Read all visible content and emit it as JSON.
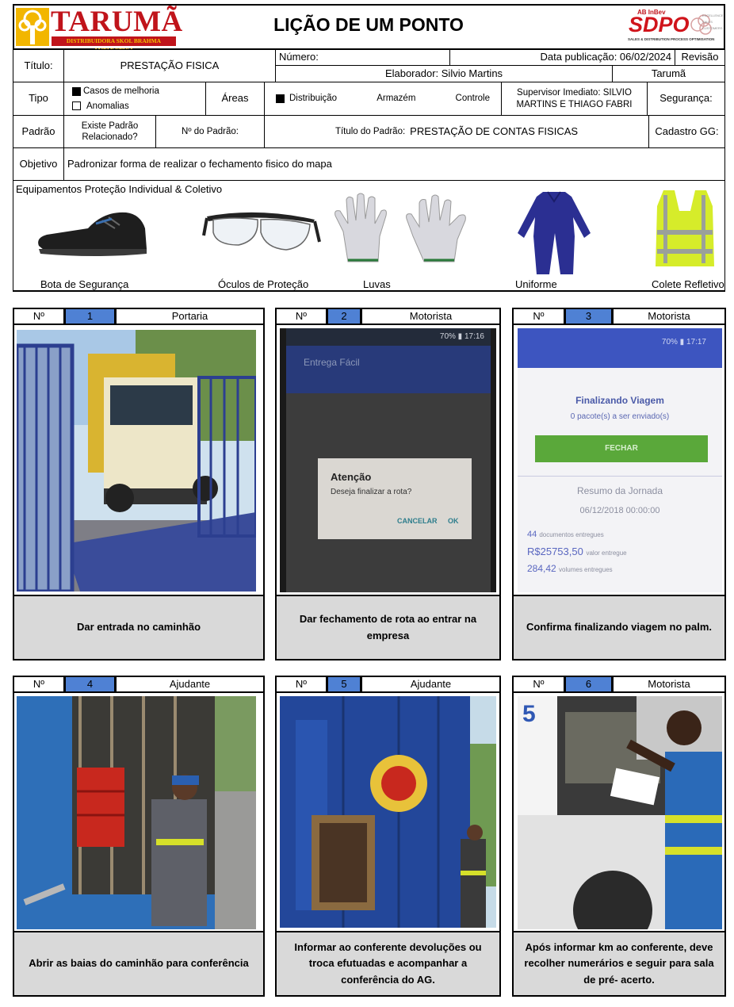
{
  "header": {
    "logo_name": "TARUMÃ",
    "logo_sub": "DISTRIBUIDORA SKOL BRAHMA ANTARCTICA",
    "doc_title": "LIÇÃO DE UM PONTO",
    "brand_small": "AB InBev",
    "brand_name": "SDPO",
    "brand_sub": "SALES & DISTRIBUTION PROCESS OPTIMISATION",
    "brand_tags": [
      "EXCELLENCE",
      "SALES",
      "CUSTOMERS"
    ]
  },
  "form": {
    "titulo_label": "Título:",
    "titulo_value": "PRESTAÇÃO FISICA",
    "numero_label": "Número:",
    "data_pub": "Data publicação: 06/02/2024",
    "revisao_label": "Revisão",
    "elaborador": "Elaborador: Silvio Martins",
    "unidade": "Tarumã",
    "tipo_label": "Tipo",
    "tipo_opt1": "Casos de melhoria",
    "tipo_opt2": "Anomalias",
    "areas_label": "Áreas",
    "area1": "Distribuição",
    "area2": "Armazém",
    "area3": "Controle",
    "supervisor": "Supervisor Imediato: SILVIO MARTINS E THIAGO FABRI",
    "seguranca_label": "Segurança:",
    "padrao_label": "Padrão",
    "existe_padrao": "Existe Padrão Relacionado?",
    "num_padrao": "Nº do Padrão:",
    "titulo_padrao_label": "Título do Padrão:",
    "titulo_padrao_value": "PRESTAÇÃO DE CONTAS FISICAS",
    "cadastro_label": "Cadastro GG:",
    "objetivo_label": "Objetivo",
    "objetivo_value": "Padronizar forma de realizar o fechamento fisico do mapa"
  },
  "epi": {
    "title": "Equipamentos Proteção Individual & Coletivo",
    "items": [
      {
        "label": "Bota de Segurança",
        "icon": "boot-icon"
      },
      {
        "label": "Óculos de Proteção",
        "icon": "goggles-icon"
      },
      {
        "label": "Luvas",
        "icon": "gloves-icon"
      },
      {
        "label": "Uniforme",
        "icon": "uniform-icon"
      },
      {
        "label": "Colete Refletivo",
        "icon": "vest-icon"
      }
    ]
  },
  "steps": [
    {
      "no_label": "Nº",
      "number": "1",
      "role": "Portaria",
      "caption": "Dar entrada no caminhão"
    },
    {
      "no_label": "Nº",
      "number": "2",
      "role": "Motorista",
      "caption": "Dar fechamento de rota ao entrar na empresa"
    },
    {
      "no_label": "Nº",
      "number": "3",
      "role": "Motorista",
      "caption": "Confirma finalizando viagem no palm."
    },
    {
      "no_label": "Nº",
      "number": "4",
      "role": "Ajudante",
      "caption": "Abrir as baias do caminhão para conferência"
    },
    {
      "no_label": "Nº",
      "number": "5",
      "role": "Ajudante",
      "caption": "Informar ao conferente devoluções ou troca efutuadas e acompanhar a conferência do AG."
    },
    {
      "no_label": "Nº",
      "number": "6",
      "role": "Motorista",
      "caption": "Após informar km ao conferente, deve recolher numerários e seguir para sala de pré- acerto."
    }
  ],
  "phone2": {
    "status": "70% ▮ 17:16",
    "app": "Entrega Fácil",
    "dialog_title": "Atenção",
    "dialog_text": "Deseja finalizar a rota?",
    "cancel": "CANCELAR",
    "ok": "OK"
  },
  "phone3": {
    "status": "70% ▮ 17:17",
    "title": "Finalizando Viagem",
    "sub": "0 pacote(s) a ser enviado(s)",
    "button": "FECHAR",
    "resumo": "Resumo da Jornada",
    "date": "06/12/2018 00:00:00",
    "s1_value": "44",
    "s1_label": "documentos entregues",
    "s2_value": "R$25753,50",
    "s2_label": "valor entregue",
    "s3_value": "284,42",
    "s3_label": "volumes entregues"
  },
  "photo6": {
    "truck_number": "5"
  },
  "colors": {
    "accent_blue": "#4f81d4",
    "caption_gray": "#d9d9d9",
    "logo_red": "#c0141b",
    "logo_yellow": "#f2c200"
  }
}
